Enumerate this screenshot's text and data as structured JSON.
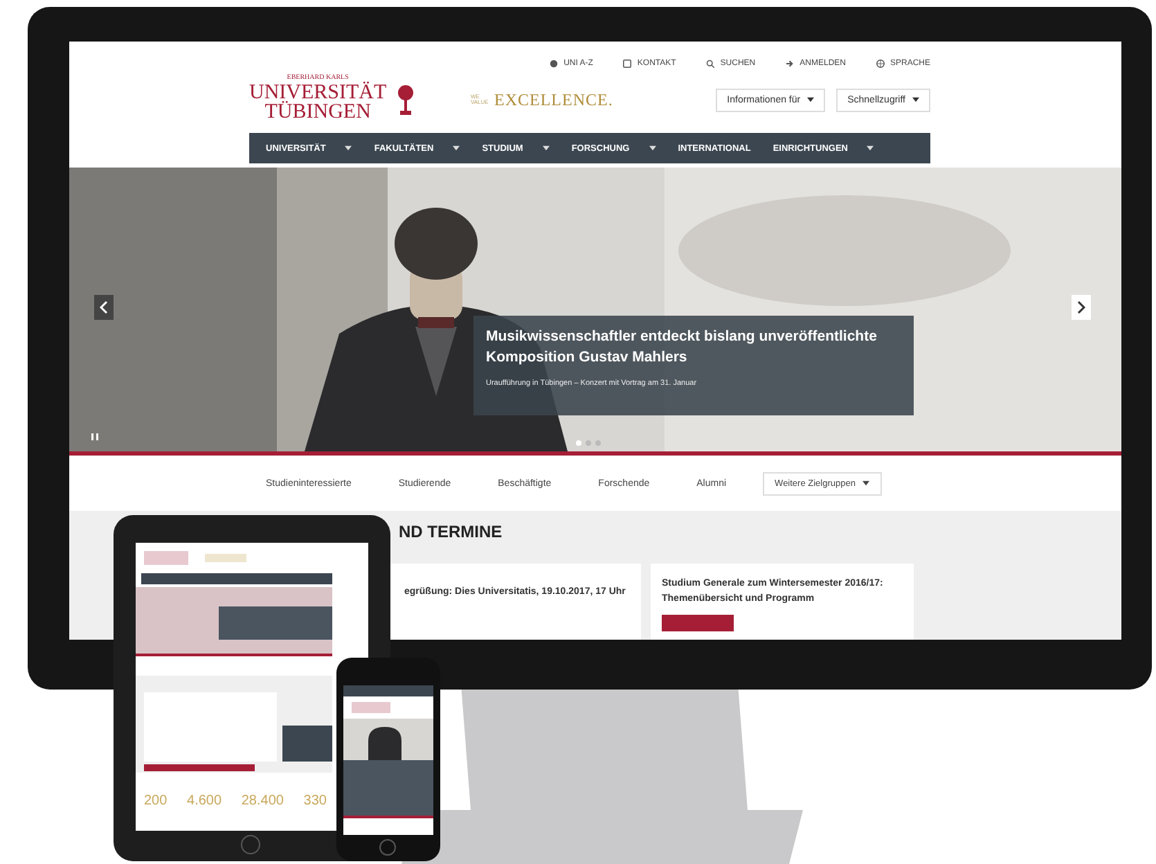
{
  "header": {
    "top_links": [
      {
        "label": "UNI A-Z"
      },
      {
        "label": "KONTAKT"
      },
      {
        "label": "SUCHEN"
      },
      {
        "label": "ANMELDEN"
      },
      {
        "label": "SPRACHE"
      }
    ],
    "logo": {
      "small": "EBERHARD KARLS",
      "line1": "UNIVERSITÄT",
      "line2": "TÜBINGEN"
    },
    "excellence": {
      "small": "WE VALUE",
      "text": "EXCELLENCE."
    },
    "dropdowns": [
      "Informationen für",
      "Schnellzugriff"
    ]
  },
  "nav": [
    {
      "label": "UNIVERSITÄT",
      "has_menu": true
    },
    {
      "label": "FAKULTÄTEN",
      "has_menu": true
    },
    {
      "label": "STUDIUM",
      "has_menu": true
    },
    {
      "label": "FORSCHUNG",
      "has_menu": true
    },
    {
      "label": "INTERNATIONAL",
      "has_menu": false
    },
    {
      "label": "EINRICHTUNGEN",
      "has_menu": true
    }
  ],
  "hero": {
    "title": "Musikwissenschaftler entdeckt bislang unveröffentlichte Komposition Gustav Mahlers",
    "subtitle": "Uraufführung in Tübingen – Konzert mit Vortrag am 31. Januar",
    "slides": [
      {
        "selected": true
      },
      {
        "selected": false
      },
      {
        "selected": false
      }
    ]
  },
  "audiences": [
    "Studieninteressierte",
    "Studierende",
    "Beschäftigte",
    "Forschende",
    "Alumni"
  ],
  "more_groups": "Weitere Zielgruppen",
  "news": {
    "heading": "ND TERMINE",
    "cards": [
      {
        "text": "egrüßung: Dies Universitatis, 19.10.2017, 17 Uhr",
        "has_button": false
      },
      {
        "text": "Studium Generale zum Wintersemester 2016/17: Themenübersicht und Programm",
        "has_button": true
      }
    ]
  },
  "tablet": {
    "stats": [
      "200",
      "4.600",
      "28.400",
      "330"
    ]
  }
}
